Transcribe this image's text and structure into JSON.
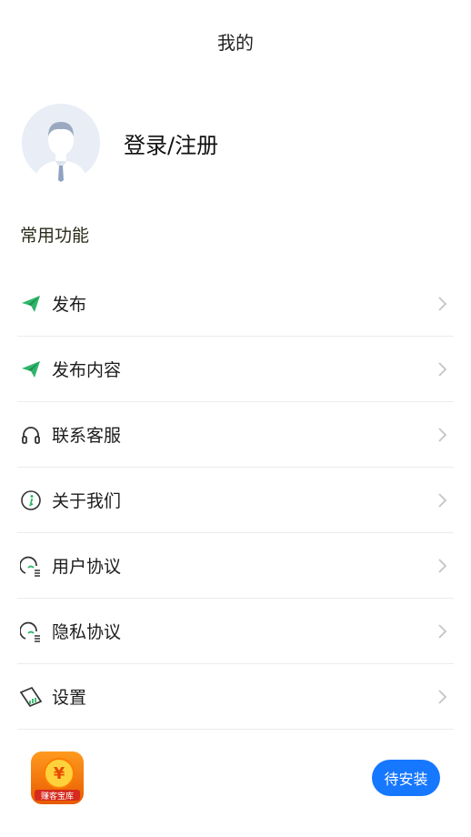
{
  "header": {
    "title": "我的"
  },
  "profile": {
    "login_label": "登录/注册"
  },
  "section": {
    "title": "常用功能"
  },
  "menu": {
    "items": [
      {
        "label": "发布",
        "icon": "paper-plane-icon"
      },
      {
        "label": "发布内容",
        "icon": "paper-plane-icon"
      },
      {
        "label": "联系客服",
        "icon": "headset-icon"
      },
      {
        "label": "关于我们",
        "icon": "info-icon"
      },
      {
        "label": "用户协议",
        "icon": "agreement-icon"
      },
      {
        "label": "隐私协议",
        "icon": "agreement-icon"
      },
      {
        "label": "设置",
        "icon": "settings-card-icon"
      }
    ]
  },
  "bottom": {
    "app_caption": "赚客宝库",
    "install_label": "待安装"
  },
  "colors": {
    "accent": "#1677ff",
    "plane_green": "#2fb56a"
  }
}
